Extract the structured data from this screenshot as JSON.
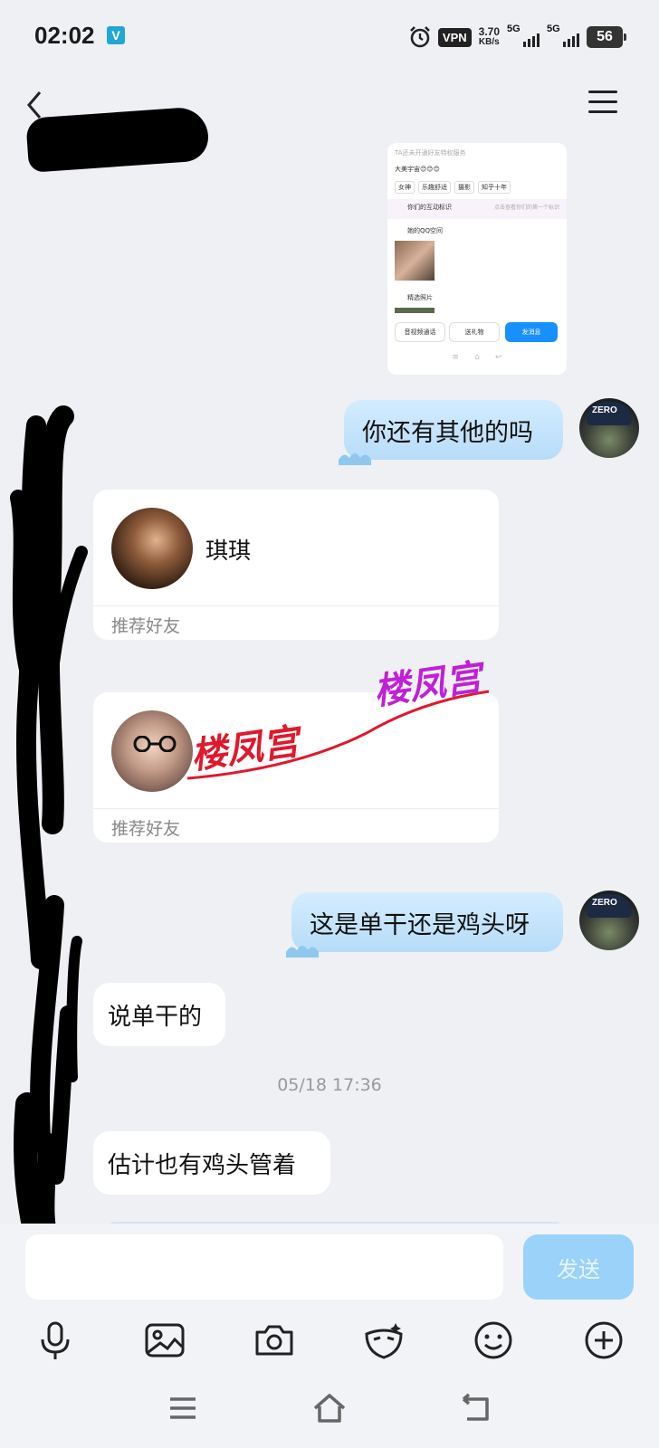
{
  "status_bar": {
    "time": "02:02",
    "v_badge": "V",
    "vpn": "VPN",
    "net_speed_value": "3.70",
    "net_speed_unit": "KB/s",
    "signal_1": "5G",
    "signal_2": "5G",
    "battery": "56"
  },
  "header": {
    "contact_name": "",
    "icons": [
      "back-icon",
      "menu-icon"
    ]
  },
  "image_message": {
    "line1": "TA还未开通好友特权服务",
    "line2": "大美宇宙😊😊😊",
    "tags": [
      "女神",
      "乐趣舒适",
      "摄影",
      "知乎十年"
    ],
    "line3": "你们的互动标识",
    "line3_right": "点击查看你们的第一个标识",
    "space": "她的QQ空间",
    "photos": "精选照片",
    "btn_call": "音视频通话",
    "btn_gift": "送礼物",
    "btn_send": "发消息"
  },
  "messages": {
    "m1": "你还有其他的吗",
    "card1_name": "琪琪",
    "card1_foot": "推荐好友",
    "card2_name": "",
    "card2_foot": "推荐好友",
    "m2": "这是单干还是鸡头呀",
    "m3": "说单干的",
    "timestamp": "05/18 17:36",
    "m4": "估计也有鸡头管着"
  },
  "watermark": {
    "text1": "楼凤宫",
    "text2": "楼凤宫"
  },
  "avatar_me_text": "ZERO",
  "input": {
    "value": "",
    "placeholder": "",
    "send_label": "发送"
  },
  "toolbar_icons": [
    "microphone-icon",
    "image-icon",
    "camera-icon",
    "mask-icon",
    "emoji-icon",
    "plus-icon"
  ],
  "nav_icons": [
    "menu-nav-icon",
    "home-icon",
    "back-nav-icon"
  ],
  "colors": {
    "bubble_me": "#b7dcf8",
    "send_button": "#9bd2f9",
    "background": "#eef0f4",
    "watermark_red": "#e0182c",
    "watermark_purple": "#c01fd6"
  }
}
